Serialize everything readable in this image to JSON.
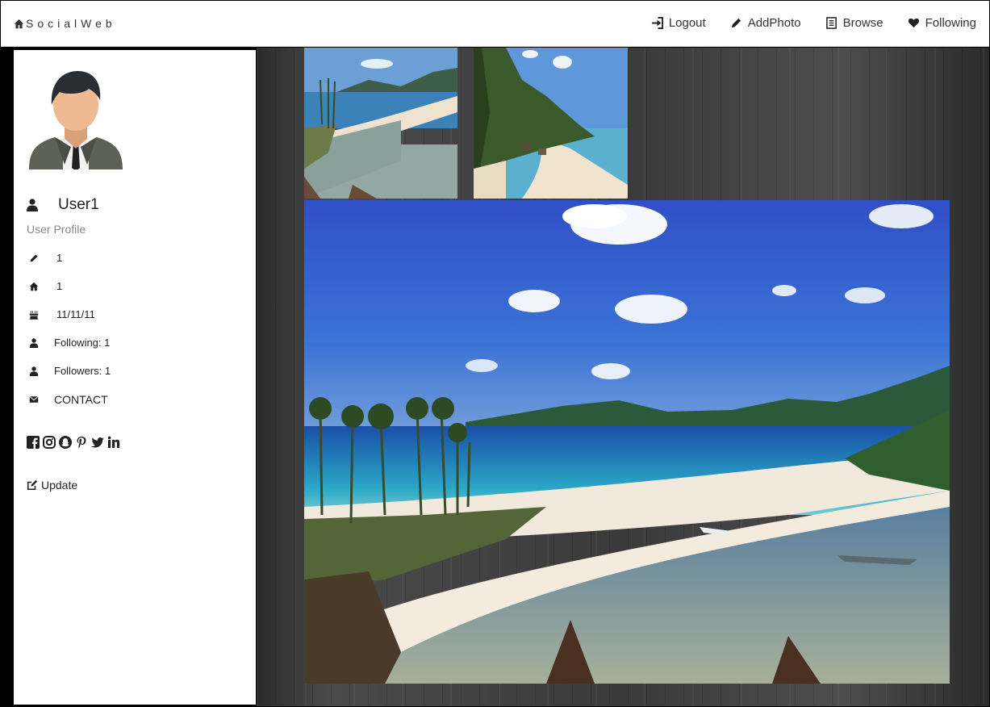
{
  "header": {
    "brand": "SocialWeb",
    "nav": [
      {
        "label": "Logout",
        "icon": "sign-in-icon"
      },
      {
        "label": "AddPhoto",
        "icon": "pencil-icon"
      },
      {
        "label": "Browse",
        "icon": "list-icon"
      },
      {
        "label": "Following",
        "icon": "heart-icon"
      }
    ]
  },
  "profile": {
    "username": "User1",
    "subtitle": "User Profile",
    "info": [
      {
        "icon": "pencil-icon",
        "text": "1"
      },
      {
        "icon": "home-icon",
        "text": "1"
      },
      {
        "icon": "birthday-cake-icon",
        "text": "11/11/11"
      },
      {
        "icon": "user-icon",
        "text": "Following: 1"
      },
      {
        "icon": "user-icon",
        "text": "Followers: 1"
      },
      {
        "icon": "envelope-icon",
        "text": "CONTACT"
      }
    ],
    "social": [
      "facebook-icon",
      "instagram-icon",
      "snapchat-icon",
      "pinterest-icon",
      "twitter-icon",
      "linkedin-icon"
    ],
    "update_label": "Update"
  },
  "photos": {
    "thumbnails": [
      "beach-thumbnail-1",
      "beach-thumbnail-2"
    ],
    "main": "beach-photo-large"
  },
  "colors": {
    "nav_text": "#333333",
    "sidebar_bg": "#ffffff",
    "subtitle": "#888888"
  }
}
